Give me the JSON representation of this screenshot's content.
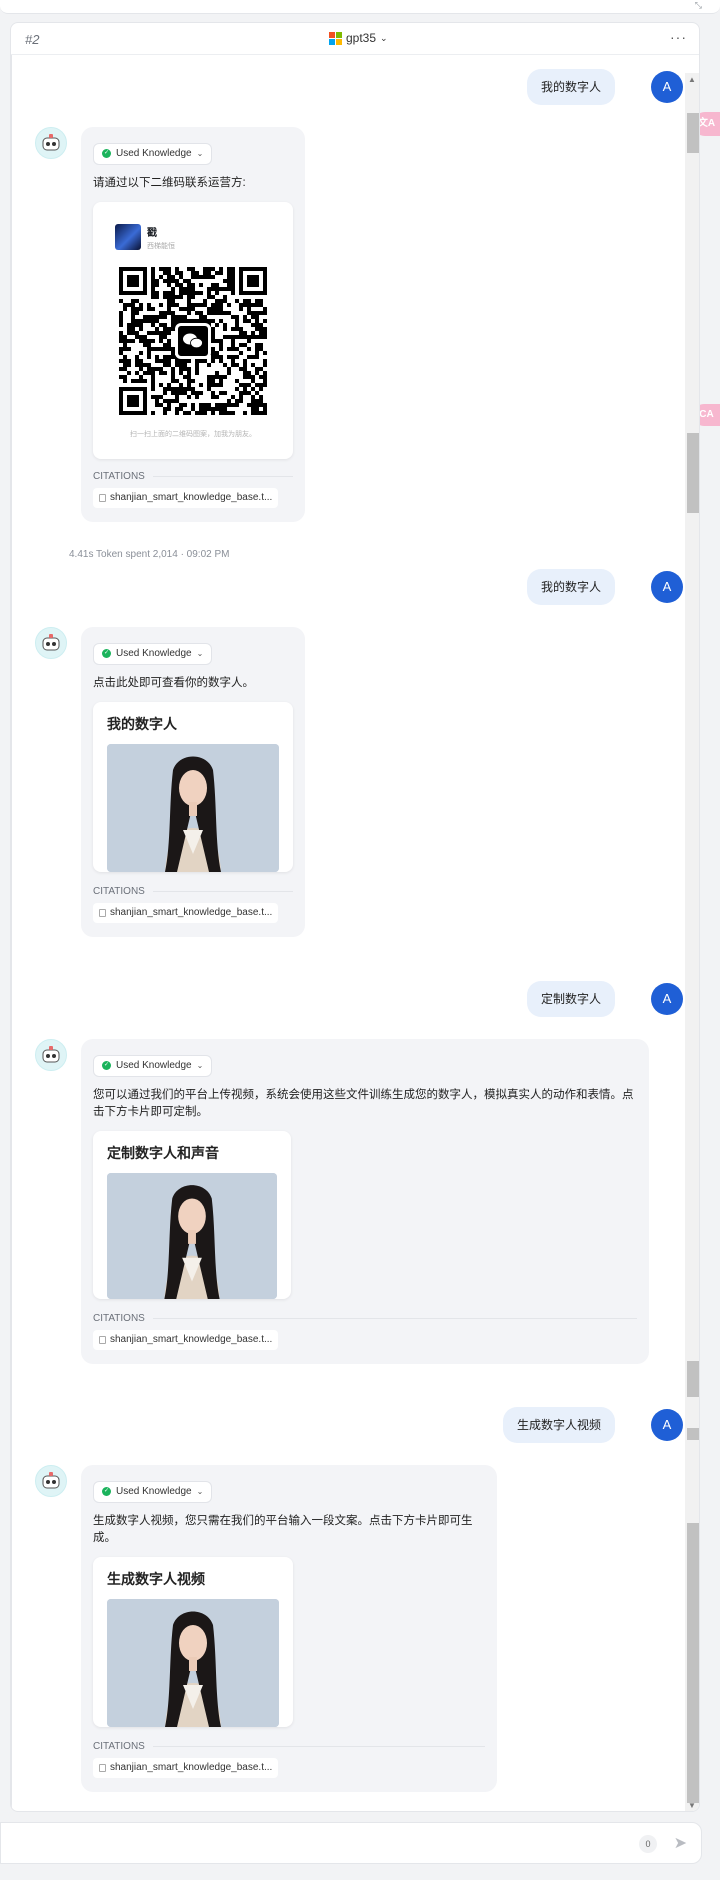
{
  "topbar": {
    "corner": "⤡"
  },
  "header": {
    "title": "#2",
    "model": "gpt35",
    "more": "···"
  },
  "user_avatar": "A",
  "messages": [
    {
      "user": "我的数字人"
    },
    {
      "knowledge": "Used Knowledge",
      "text": "请通过以下二维码联系运营方:",
      "qr": {
        "name": "戳",
        "sub": "西梯能恒",
        "hint": "扫一扫上面的二维码图案，加我为朋友。"
      },
      "citations": "CITATIONS",
      "file": "shanjian_smart_knowledge_base.t..."
    },
    {
      "meta": "4.41s  Token spent 2,014  ·  09:02 PM"
    },
    {
      "user": "我的数字人"
    },
    {
      "knowledge": "Used Knowledge",
      "text": "点击此处即可查看你的数字人。",
      "card": "我的数字人",
      "citations": "CITATIONS",
      "file": "shanjian_smart_knowledge_base.t..."
    },
    {
      "user": "定制数字人"
    },
    {
      "knowledge": "Used Knowledge",
      "text": "您可以通过我们的平台上传视频，系统会使用这些文件训练生成您的数字人，模拟真实人的动作和表情。点击下方卡片即可定制。",
      "card": "定制数字人和声音",
      "citations": "CITATIONS",
      "file": "shanjian_smart_knowledge_base.t..."
    },
    {
      "user": "生成数字人视频"
    },
    {
      "knowledge": "Used Knowledge",
      "text": "生成数字人视频，您只需在我们的平台输入一段文案。点击下方卡片即可生成。",
      "card": "生成数字人视频",
      "citations": "CITATIONS",
      "file": "shanjian_smart_knowledge_base.t..."
    }
  ],
  "input": {
    "count": "0"
  },
  "side_tabs": [
    "文A",
    "CA"
  ]
}
